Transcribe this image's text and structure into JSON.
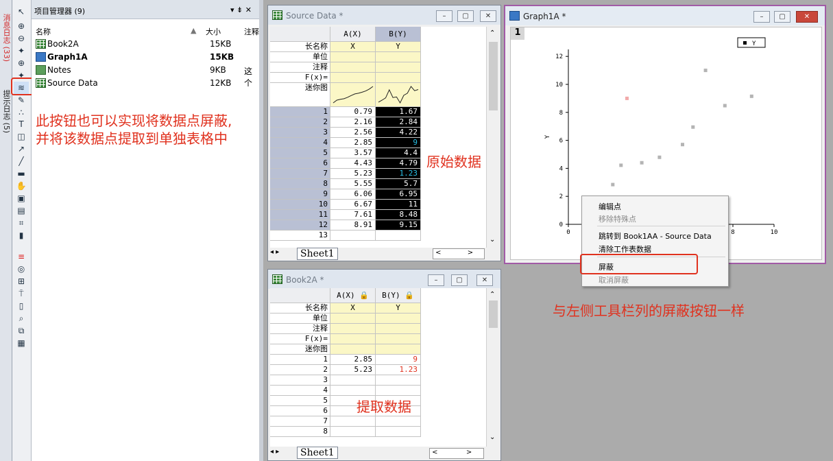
{
  "side_tabs": {
    "messages": "消息日志 (33)",
    "hints": "提示日志 (5)"
  },
  "project_explorer": {
    "title": "项目管理器 (9)",
    "title_controls": "▾ ⇟ ✕",
    "columns": {
      "name": "名称",
      "size": "大小",
      "note": "注释"
    },
    "items": [
      {
        "name": "Book2A",
        "size": "15KB",
        "note": "",
        "icon": "workbook-icon"
      },
      {
        "name": "Graph1A",
        "size": "15KB",
        "note": "",
        "icon": "graph-icon"
      },
      {
        "name": "Notes",
        "size": "9KB",
        "note": "这个",
        "icon": "notes-icon"
      },
      {
        "name": "Source Data",
        "size": "12KB",
        "note": "",
        "icon": "workbook-icon"
      }
    ]
  },
  "source_data": {
    "title": "Source Data *",
    "col_a": "A(X)",
    "col_b": "B(Y)",
    "row_labels": [
      "长名称",
      "单位",
      "注释",
      "F(x)=",
      "迷你图"
    ],
    "longname_a": "X",
    "longname_b": "Y",
    "rows": [
      [
        "1",
        "0.79",
        "1.67"
      ],
      [
        "2",
        "2.16",
        "2.84"
      ],
      [
        "3",
        "2.56",
        "4.22"
      ],
      [
        "4",
        "2.85",
        "9"
      ],
      [
        "5",
        "3.57",
        "4.4"
      ],
      [
        "6",
        "4.43",
        "4.79"
      ],
      [
        "7",
        "5.23",
        "1.23"
      ],
      [
        "8",
        "5.55",
        "5.7"
      ],
      [
        "9",
        "6.06",
        "6.95"
      ],
      [
        "10",
        "6.67",
        "11"
      ],
      [
        "11",
        "7.61",
        "8.48"
      ],
      [
        "12",
        "8.91",
        "9.15"
      ],
      [
        "13",
        "",
        ""
      ]
    ],
    "masked_rows": [
      3,
      6
    ],
    "sheet": "Sheet1"
  },
  "book2a": {
    "title": "Book2A *",
    "col_a": "A(X)",
    "col_b": "B(Y)",
    "row_labels": [
      "长名称",
      "单位",
      "注释",
      "F(x)=",
      "迷你图"
    ],
    "longname_a": "X",
    "longname_b": "Y",
    "rows": [
      [
        "1",
        "2.85",
        "9"
      ],
      [
        "2",
        "5.23",
        "1.23"
      ],
      [
        "3",
        "",
        ""
      ],
      [
        "4",
        "",
        ""
      ],
      [
        "5",
        "",
        ""
      ],
      [
        "6",
        "",
        ""
      ],
      [
        "7",
        "",
        ""
      ],
      [
        "8",
        "",
        ""
      ]
    ],
    "sheet": "Sheet1"
  },
  "graph": {
    "title": "Graph1A *",
    "layer": "1",
    "legend": "Y",
    "y_ticks": [
      "0",
      "2",
      "4",
      "6",
      "8",
      "10",
      "12"
    ],
    "x_ticks": [
      "0",
      "8",
      "10"
    ],
    "ylabel": "Y"
  },
  "chart_data": {
    "type": "scatter",
    "series": [
      {
        "name": "Y",
        "x": [
          0.79,
          2.16,
          2.56,
          2.85,
          3.57,
          4.43,
          5.23,
          5.55,
          6.06,
          6.67,
          7.61,
          8.91
        ],
        "y": [
          1.67,
          2.84,
          4.22,
          9,
          4.4,
          4.79,
          1.23,
          5.7,
          6.95,
          11,
          8.48,
          9.15
        ]
      }
    ],
    "masked_indices": [
      3,
      6
    ],
    "xlim": [
      0,
      10
    ],
    "ylim": [
      0,
      12.5
    ],
    "ylabel": "Y",
    "colors": {
      "normal": "#b4b4b4",
      "masked": "#f2aaaa"
    }
  },
  "context_menu": {
    "items": [
      {
        "label": "编辑点",
        "enabled": true
      },
      {
        "label": "移除特殊点",
        "enabled": false
      },
      {
        "label": "跳转到 Book1AA - Source Data",
        "enabled": true
      },
      {
        "label": "清除工作表数据",
        "enabled": true
      },
      {
        "label": "屏蔽",
        "enabled": true
      },
      {
        "label": "取消屏蔽",
        "enabled": false
      }
    ]
  },
  "annotations": {
    "toolbar_note_line1": "此按钮也可以实现将数据点屏蔽,",
    "toolbar_note_line2": "并将该数据点提取到单独表格中",
    "original_data": "原始数据",
    "extracted_data": "提取数据",
    "same_as_toolbar": "与左侧工具栏列的屏蔽按钮一样"
  },
  "colors": {
    "accent_red": "#e0311e",
    "graph_border": "#a15aa6",
    "row_header_selected": "#b9c0d4",
    "column_highlight": "#fbf7c6"
  }
}
